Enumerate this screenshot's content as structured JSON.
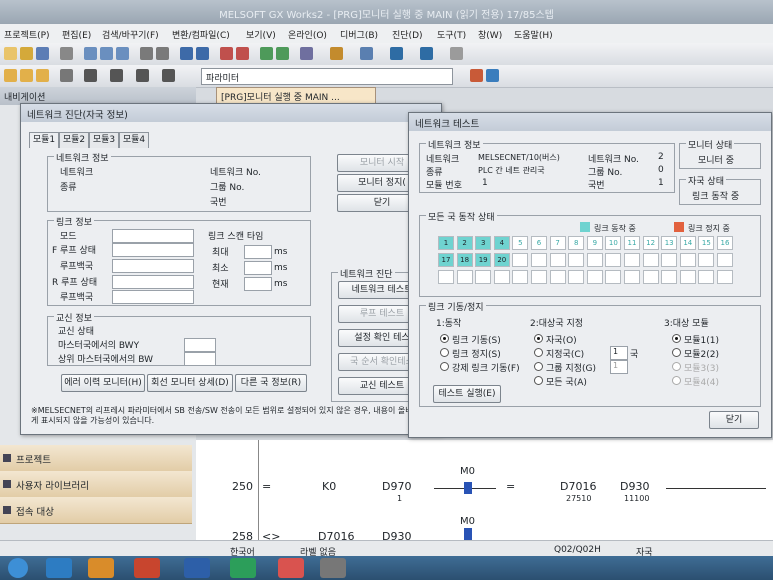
{
  "window": {
    "title": "MELSOFT GX Works2 - [PRG]모니터 실행 중 MAIN (읽기 전용) 17/85스텝"
  },
  "menu": [
    "프로젝트(P)",
    "편집(E)",
    "검색/바꾸기(F)",
    "변환/컴파일(C)",
    "보기(V)",
    "온라인(O)",
    "디버그(B)",
    "진단(D)",
    "도구(T)",
    "창(W)",
    "도움말(H)"
  ],
  "toolbar": {
    "param_label": "파라미터"
  },
  "navigation": {
    "title": "내비게이션",
    "items": [
      "프로젝트",
      "사용자 라이브러리",
      "접속 대상"
    ]
  },
  "doc_tab": {
    "label": "[PRG]모니터 실행 중 MAIN ..."
  },
  "diag": {
    "title": "네트워크 진단(자국 정보)",
    "tabs": [
      "모듈1",
      "모듈2",
      "모듈3",
      "모듈4"
    ],
    "net_info": {
      "title": "네트워크 정보",
      "network": "네트워크",
      "kind": "종류",
      "network_no": "네트워크 No.",
      "group_no": "그룹 No.",
      "station": "국번"
    },
    "link_info": {
      "title": "링크 정보",
      "mode": "모드",
      "f_loop": "F 루프 상태",
      "loop_back1": "루프백국",
      "r_loop": "R 루프 상태",
      "loop_back2": "루프백국",
      "scan_title": "링크 스캔 타임",
      "max": "최대",
      "min": "최소",
      "current": "현재",
      "unit": "ms"
    },
    "comm_info": {
      "title": "교신 정보",
      "comm_state": "교신 상태",
      "bwy": "마스터국에서의 BWY",
      "bw": "상위 마스터국에서의 BW"
    },
    "buttons": {
      "error_history": "에러 이력 모니터(H)",
      "line_monitor": "회선 모니터 상세(D)",
      "other_station": "다른 국 정보(R)",
      "monitor_start": "모니터 시작",
      "monitor_stop": "모니터 정지(",
      "close": "닫기"
    },
    "net_test_group": "네트워크 진단",
    "test_buttons": [
      "네트워크 테스트",
      "루프 테스트",
      "설정 확인 테스",
      "국 순서 확인테스",
      "교신 테스트"
    ],
    "note": "※MELSECNET의 리프레시 파라미터에서 SB 전송/SW 전송이 모든 범위로 설정되어 있지 않은 경우, 내용이 올바르게 표시되지 않을 가능성이 있습니다."
  },
  "test": {
    "title": "네트워크 테스트",
    "net_info": {
      "title": "네트워크 정보",
      "network_label": "네트워크",
      "network_value": "MELSECNET/10(버스)",
      "kind_label": "종류",
      "kind_value": "PLC 간 네트 관리국",
      "module_label": "모듈 번호",
      "module_value": "1",
      "network_no_label": "네트워크 No.",
      "network_no_value": "2",
      "group_label": "그룹 No.",
      "group_value": "0",
      "station_label": "국번",
      "station_value": "1"
    },
    "monitor_state": {
      "title": "모니터 상태",
      "value": "모니터 중"
    },
    "station_state": {
      "title": "자국 상태",
      "value": "링크 동작 중"
    },
    "all_status": {
      "title": "모든 국 동작 상태",
      "legend_running": "링크 동작 중",
      "legend_stopped": "링크 정지 중",
      "running_color": "#6fd3d0",
      "stopped_color": "#e2613e",
      "row1": [
        "1",
        "2",
        "3",
        "4",
        "5",
        "6",
        "7",
        "8",
        "9",
        "10",
        "11",
        "12",
        "13",
        "14",
        "15",
        "16"
      ],
      "row2": [
        "17",
        "18",
        "19",
        "20"
      ],
      "active": [
        1,
        2,
        3,
        4,
        17,
        18,
        19,
        20
      ]
    },
    "link_control": {
      "title": "링크 기동/정지",
      "op_title": "1:동작",
      "op_options": [
        "링크 기동(S)",
        "링크 정지(S)",
        "강제 링크 기동(F)"
      ],
      "target_title": "2:대상국 지정",
      "target_options": [
        "자국(O)",
        "지정국(C)",
        "그룹 지정(G)",
        "모든 국(A)"
      ],
      "station_field": "1",
      "station_unit": "국",
      "group_field": "1",
      "module_title": "3:대상 모듈",
      "module_options": [
        "모듈1(1)",
        "모듈2(2)",
        "모듈3(3)",
        "모듈4(4)"
      ]
    },
    "buttons": {
      "execute": "테스트 실행(E)",
      "close": "닫기"
    }
  },
  "ladder": {
    "rows": [
      {
        "step": "250",
        "op": "=",
        "a": "K0",
        "b": "D970",
        "b_val": "1",
        "contact": "M0",
        "op2": "=",
        "c": "D7016",
        "c_val": "27510",
        "d": "D930",
        "d_val": "11100"
      },
      {
        "step": "258",
        "op": "<>",
        "a": "",
        "b": "D7016",
        "b_val": "",
        "contact": "M0",
        "op2": "",
        "c": "D930",
        "c_val": "",
        "d": "",
        "d_val": ""
      }
    ]
  },
  "status": {
    "lang": "한국어",
    "label_use": "라벨 없음",
    "cpu": "Q02/Q02H",
    "station": "자국"
  }
}
